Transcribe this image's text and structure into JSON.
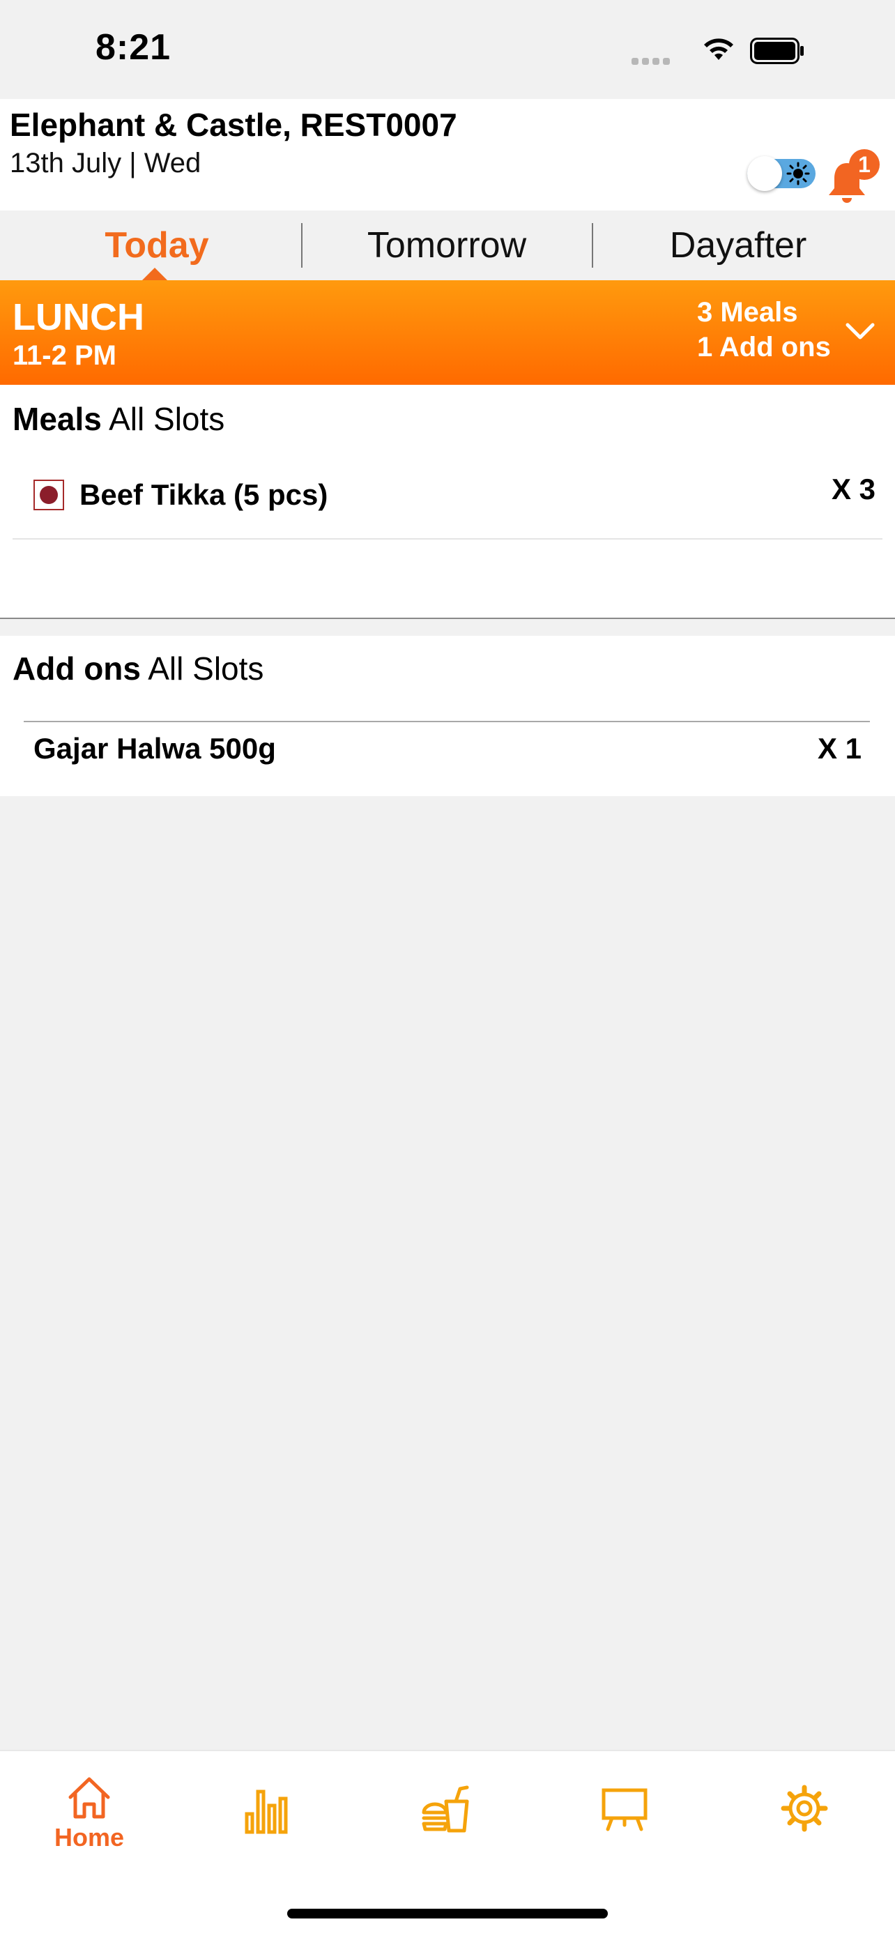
{
  "status_bar": {
    "time": "8:21"
  },
  "header": {
    "store_name": "Elephant & Castle, REST0007",
    "date": "13th July | Wed",
    "notification_count": "1"
  },
  "tabs": [
    {
      "label": "Today",
      "active": true
    },
    {
      "label": "Tomorrow",
      "active": false
    },
    {
      "label": "Dayafter",
      "active": false
    }
  ],
  "meal_banner": {
    "title": "LUNCH",
    "time": "11-2 PM",
    "meals_summary": "3 Meals",
    "addons_summary": "1 Add ons"
  },
  "meals_section": {
    "title_bold": "Meals",
    "title_rest": "All Slots",
    "items": [
      {
        "name": "Beef Tikka (5 pcs)",
        "qty": "X 3",
        "type": "non-veg"
      }
    ]
  },
  "addons_section": {
    "title_bold": "Add ons",
    "title_rest": "All Slots",
    "items": [
      {
        "name": "Gajar Halwa 500g",
        "qty": "X 1"
      }
    ]
  },
  "bottom_nav": {
    "items": [
      {
        "label": "Home",
        "icon": "home-icon",
        "active": true
      },
      {
        "label": "",
        "icon": "bar-chart-icon"
      },
      {
        "label": "",
        "icon": "burger-drink-icon"
      },
      {
        "label": "",
        "icon": "easel-icon"
      },
      {
        "label": "",
        "icon": "gear-icon"
      }
    ]
  },
  "colors": {
    "accent": "#f26b1d",
    "banner_top": "#ff9a0e",
    "banner_bottom": "#ff6a00",
    "toggle": "#5aa8e0"
  }
}
